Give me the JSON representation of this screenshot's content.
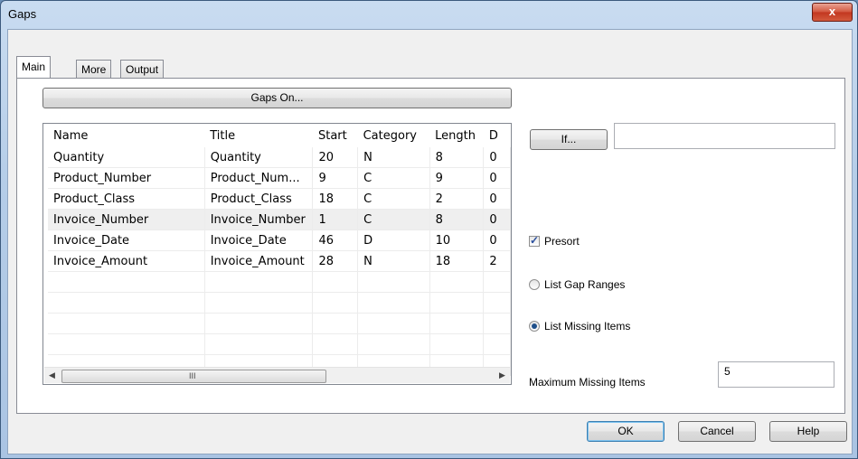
{
  "window": {
    "title": "Gaps",
    "close_icon": "x-icon",
    "close_glyph": "x"
  },
  "tabs": [
    {
      "label": "Main",
      "active": true
    },
    {
      "label": "More",
      "active": false
    },
    {
      "label": "Output",
      "active": false
    }
  ],
  "main": {
    "gaps_on_label": "Gaps On...",
    "if_label": "If...",
    "if_value": "",
    "fields_table": {
      "columns": [
        "Name",
        "Title",
        "Start",
        "Category",
        "Length",
        "D"
      ],
      "rows": [
        [
          "Quantity",
          "Quantity",
          "20",
          "N",
          "8",
          "0"
        ],
        [
          "Product_Number",
          "Product_Num...",
          "9",
          "C",
          "9",
          "0"
        ],
        [
          "Product_Class",
          "Product_Class",
          "18",
          "C",
          "2",
          "0"
        ],
        [
          "Invoice_Number",
          "Invoice_Number",
          "1",
          "C",
          "8",
          "0"
        ],
        [
          "Invoice_Date",
          "Invoice_Date",
          "46",
          "D",
          "10",
          "0"
        ],
        [
          "Invoice_Amount",
          "Invoice_Amount",
          "28",
          "N",
          "18",
          "2"
        ]
      ],
      "selected_row": 3
    },
    "scroll_grip": "III",
    "presort": {
      "label": "Presort",
      "checked": true
    },
    "list_gap_ranges": {
      "label": "List Gap Ranges",
      "selected": false
    },
    "list_missing_items": {
      "label": "List Missing Items",
      "selected": true
    },
    "max_missing": {
      "label": "Maximum Missing Items",
      "value": "5"
    }
  },
  "footer": {
    "ok_label": "OK",
    "cancel_label": "Cancel",
    "help_label": "Help"
  }
}
